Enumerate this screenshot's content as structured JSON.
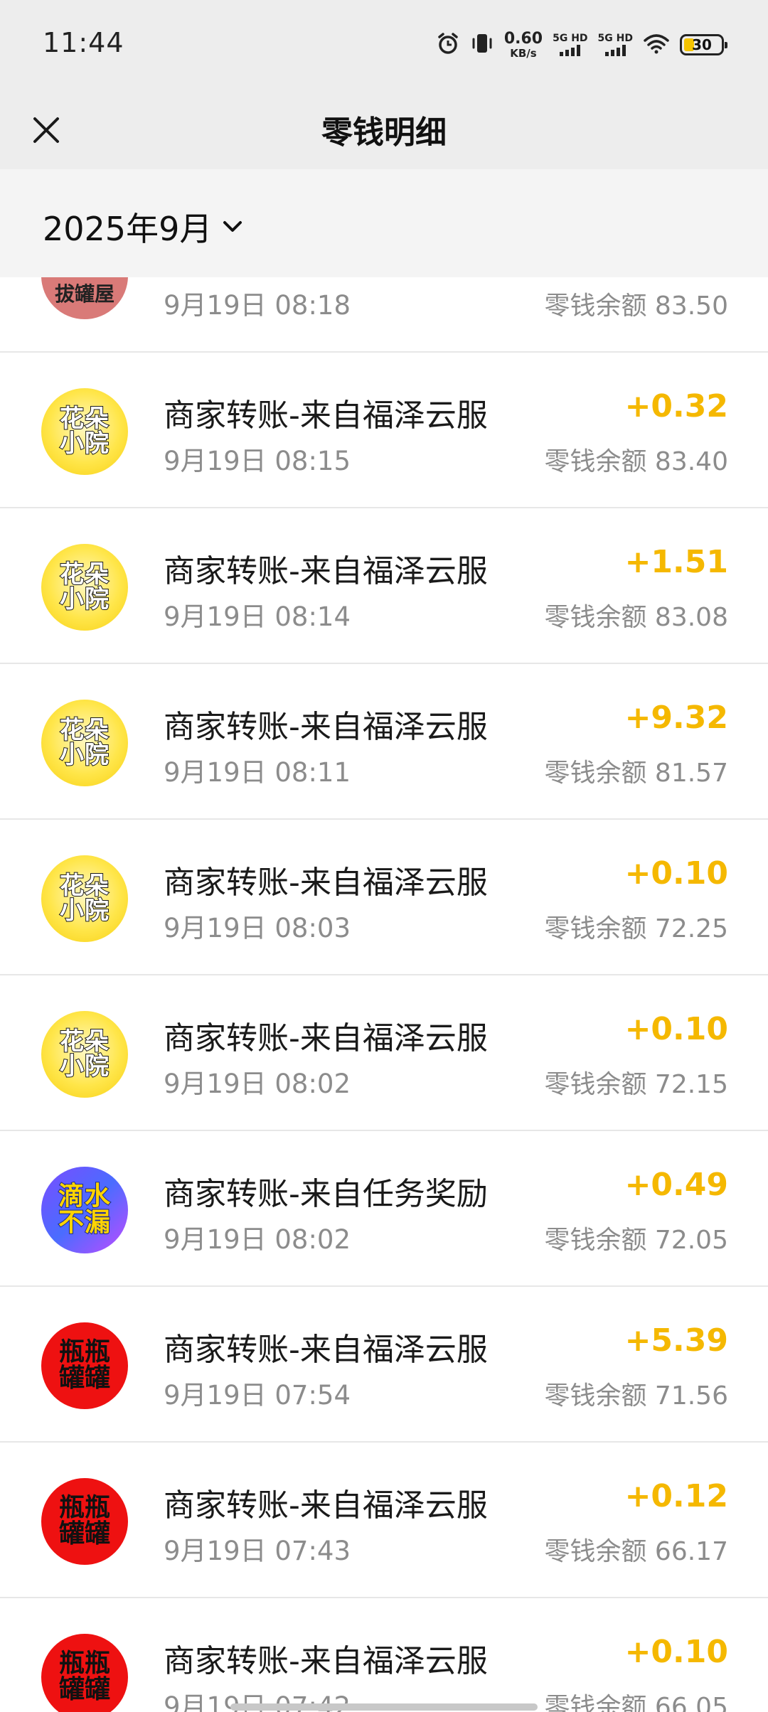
{
  "status_bar": {
    "time": "11:44",
    "net_speed": "0.60",
    "net_unit": "KB/s",
    "sim1": "5G HD",
    "sim2": "5G HD",
    "battery": "30"
  },
  "header": {
    "title": "零钱明细",
    "close_icon": "close-icon"
  },
  "filter": {
    "month": "2025年9月",
    "dropdown_icon": "chevron-down-icon"
  },
  "colors": {
    "amount": "#f5b800",
    "secondary_text": "#8c8c8c",
    "header_bg": "#ededed"
  },
  "transactions": [
    {
      "avatar": "拔罐屋",
      "title": "",
      "time": "9月19日 08:18",
      "amount": "",
      "balance": "零钱余额 83.50"
    },
    {
      "avatar": "花朵小院",
      "title": "商家转账-来自福泽云服",
      "time": "9月19日 08:15",
      "amount": "+0.32",
      "balance": "零钱余额 83.40"
    },
    {
      "avatar": "花朵小院",
      "title": "商家转账-来自福泽云服",
      "time": "9月19日 08:14",
      "amount": "+1.51",
      "balance": "零钱余额 83.08"
    },
    {
      "avatar": "花朵小院",
      "title": "商家转账-来自福泽云服",
      "time": "9月19日 08:11",
      "amount": "+9.32",
      "balance": "零钱余额 81.57"
    },
    {
      "avatar": "花朵小院",
      "title": "商家转账-来自福泽云服",
      "time": "9月19日 08:03",
      "amount": "+0.10",
      "balance": "零钱余额 72.25"
    },
    {
      "avatar": "花朵小院",
      "title": "商家转账-来自福泽云服",
      "time": "9月19日 08:02",
      "amount": "+0.10",
      "balance": "零钱余额 72.15"
    },
    {
      "avatar": "滴水不漏",
      "title": "商家转账-来自任务奖励",
      "time": "9月19日 08:02",
      "amount": "+0.49",
      "balance": "零钱余额 72.05"
    },
    {
      "avatar": "瓶瓶罐罐",
      "title": "商家转账-来自福泽云服",
      "time": "9月19日 07:54",
      "amount": "+5.39",
      "balance": "零钱余额 71.56"
    },
    {
      "avatar": "瓶瓶罐罐",
      "title": "商家转账-来自福泽云服",
      "time": "9月19日 07:43",
      "amount": "+0.12",
      "balance": "零钱余额 66.17"
    },
    {
      "avatar": "瓶瓶罐罐",
      "title": "商家转账-来自福泽云服",
      "time": "9月19日 07:42",
      "amount": "+0.10",
      "balance": "零钱余额 66.05"
    }
  ]
}
